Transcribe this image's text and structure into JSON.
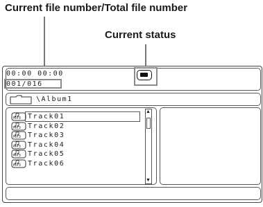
{
  "callouts": {
    "file_number": "Current file number/Total file number",
    "status": "Current status"
  },
  "status_bar": {
    "time": "00:00  00:00",
    "file_count": "001/016",
    "status_icon": "stop-icon"
  },
  "path": {
    "folder_icon": "folder-icon",
    "album": "\\Album1"
  },
  "tracks": [
    {
      "badge": "MP3",
      "label": "Track01",
      "selected": true
    },
    {
      "badge": "MP3",
      "label": "Track02",
      "selected": false
    },
    {
      "badge": "MP3",
      "label": "Track03",
      "selected": false
    },
    {
      "badge": "MP3",
      "label": "Track04",
      "selected": false
    },
    {
      "badge": "MP3",
      "label": "Track05",
      "selected": false
    },
    {
      "badge": "MP3",
      "label": "Track06",
      "selected": false
    }
  ]
}
